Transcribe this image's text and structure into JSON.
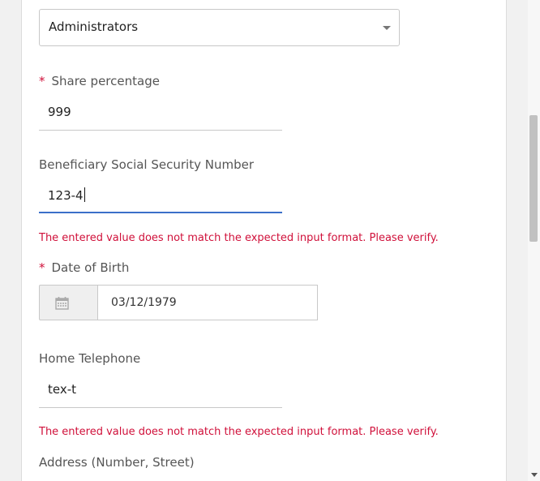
{
  "group_select": {
    "value": "Administrators"
  },
  "share_percentage": {
    "label": "Share percentage",
    "required_mark": "*",
    "value": "999"
  },
  "ssn": {
    "label": "Beneficiary Social Security Number",
    "value": "123-4",
    "error": "The entered value does not match the expected input format. Please verify."
  },
  "dob": {
    "label": "Date of Birth",
    "required_mark": "*",
    "value": "03/12/1979",
    "icon": "calendar-icon"
  },
  "home_phone": {
    "label": "Home Telephone",
    "value": "tex-t",
    "error": "The entered value does not match the expected input format. Please verify."
  },
  "address": {
    "label": "Address (Number, Street)"
  },
  "colors": {
    "error": "#d0103a",
    "focus": "#3b6fc9"
  }
}
